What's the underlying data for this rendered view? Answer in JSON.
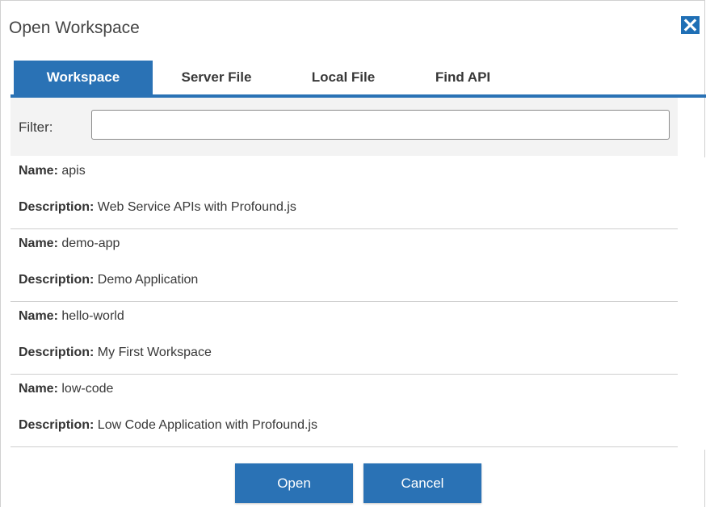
{
  "dialog": {
    "title": "Open Workspace",
    "close_icon": "close-icon"
  },
  "tabs": [
    {
      "label": "Workspace",
      "active": true
    },
    {
      "label": "Server File",
      "active": false
    },
    {
      "label": "Local File",
      "active": false
    },
    {
      "label": "Find API",
      "active": false
    }
  ],
  "filter": {
    "label": "Filter:",
    "value": "",
    "placeholder": ""
  },
  "workspaces": {
    "name_key": "Name:",
    "description_key": "Description:",
    "items": [
      {
        "name": "apis",
        "description": "Web Service APIs with Profound.js"
      },
      {
        "name": "demo-app",
        "description": "Demo Application"
      },
      {
        "name": "hello-world",
        "description": "My First Workspace"
      },
      {
        "name": "low-code",
        "description": "Low Code Application with Profound.js"
      }
    ]
  },
  "buttons": {
    "open_label": "Open",
    "cancel_label": "Cancel"
  },
  "colors": {
    "accent": "#2a72b5",
    "close_bg": "#1f6fb5",
    "filter_bg": "#f3f3f3"
  }
}
